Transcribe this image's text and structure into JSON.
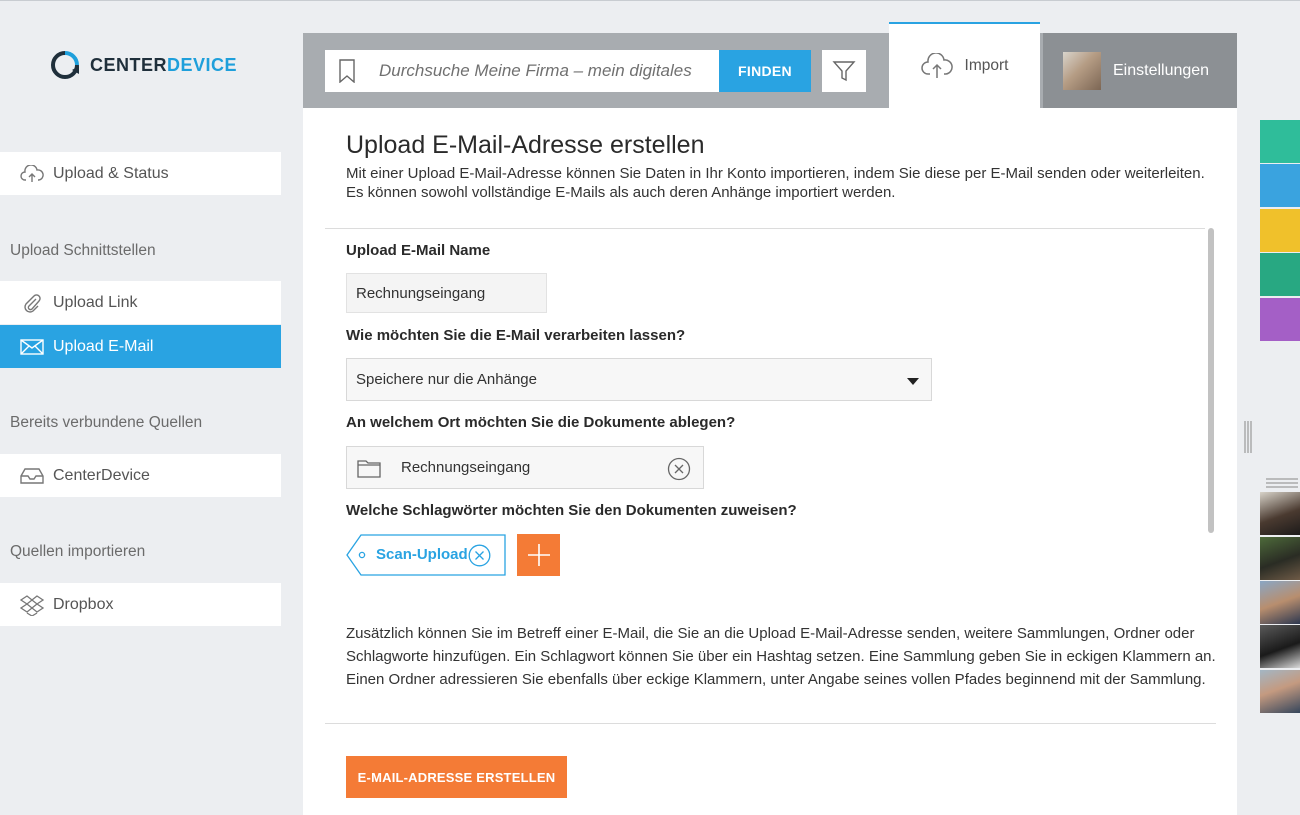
{
  "app": {
    "logo_part1": "CENTER",
    "logo_part2": "DEVICE"
  },
  "sidebar": {
    "upload_status": "Upload & Status",
    "heading_interfaces": "Upload Schnittstellen",
    "upload_link": "Upload Link",
    "upload_email": "Upload E-Mail",
    "heading_connected": "Bereits verbundene Quellen",
    "centerdevice": "CenterDevice",
    "heading_import": "Quellen importieren",
    "dropbox": "Dropbox"
  },
  "header": {
    "search_placeholder": "Durchsuche Meine Firma – mein digitales",
    "search_button": "FINDEN",
    "import_tab": "Import",
    "settings_tab": "Einstellungen"
  },
  "main": {
    "title": "Upload E-Mail-Adresse erstellen",
    "description": "Mit einer Upload E-Mail-Adresse können Sie Daten in Ihr Konto importieren, indem Sie diese per E-Mail senden oder weiterleiten. Es können sowohl vollständige E-Mails als auch deren Anhänge importiert werden.",
    "name_label": "Upload E-Mail Name",
    "name_value": "Rechnungseingang",
    "process_label": "Wie möchten Sie die E-Mail verarbeiten lassen?",
    "process_value": "Speichere nur die Anhänge",
    "location_label": "An welchem Ort möchten Sie die Dokumente ablegen?",
    "location_value": "Rechnungseingang",
    "tags_label": "Welche Schlagwörter möchten Sie den Dokumenten zuweisen?",
    "tag_value": "Scan-Upload",
    "info_text": "Zusätzlich können Sie im Betreff einer E-Mail, die Sie an die Upload E-Mail-Adresse senden, weitere Sammlungen, Ordner oder Schlagworte hinzufügen. Ein Schlagwort können Sie über ein Hashtag setzen. Eine Sammlung geben Sie in eckigen Klammern an. Einen Ordner adressieren Sie ebenfalls über eckige Klammern, unter Angabe seines vollen Pfades beginnend mit der Sammlung.",
    "create_button": "E-MAIL-ADRESSE ERSTELLEN"
  },
  "colors": {
    "accent_blue": "#29a3e2",
    "accent_orange": "#f47b36",
    "rail_tabs": [
      "#2fbd9a",
      "#3aa3df",
      "#f0c12b",
      "#28a882",
      "#a45fc6"
    ]
  }
}
